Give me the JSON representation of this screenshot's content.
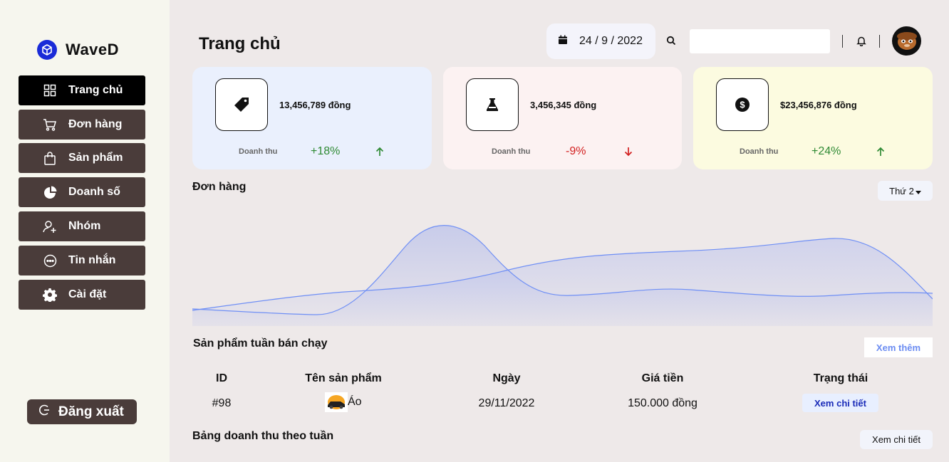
{
  "brand": {
    "name": "WaveD",
    "color": "#1a2bd8"
  },
  "sidebar": {
    "items": [
      {
        "label": "Trang chủ",
        "icon": "grid-icon",
        "active": true
      },
      {
        "label": "Đơn hàng",
        "icon": "cart-icon"
      },
      {
        "label": "Sản phẩm",
        "icon": "bag-icon"
      },
      {
        "label": "Doanh số",
        "icon": "pie-chart-icon"
      },
      {
        "label": "Nhóm",
        "icon": "user-add-icon"
      },
      {
        "label": "Tin nhắn",
        "icon": "message-icon"
      },
      {
        "label": "Cài đặt",
        "icon": "gear-icon"
      }
    ],
    "logout_label": "Đăng xuất"
  },
  "header": {
    "title": "Trang chủ",
    "date": "24 / 9 / 2022",
    "search_placeholder": ""
  },
  "stats": [
    {
      "amount": "13,456,789 đồng",
      "label": "Doanh thu",
      "change": "+18%",
      "trend": "up",
      "icon": "price-tag-icon",
      "bg": "#eaf0fd"
    },
    {
      "amount": "3,456,345 đồng",
      "label": "Doanh thu",
      "change": "-9%",
      "trend": "down",
      "icon": "flask-icon",
      "bg": "#fcf2f2"
    },
    {
      "amount": "$23,456,876 đồng",
      "label": "Doanh thu",
      "change": "+24%",
      "trend": "up",
      "icon": "dollar-icon",
      "bg": "#fcfbe0"
    }
  ],
  "orders": {
    "title": "Đơn hàng",
    "day_select": "Thứ 2"
  },
  "top_products": {
    "title": "Sản phẩm tuần bán chạy",
    "more_label": "Xem thêm",
    "columns": [
      "ID",
      "Tên sản phẩm",
      "Ngày",
      "Giá tiền",
      "Trạng thái"
    ],
    "rows": [
      {
        "id": "#98",
        "name": "Áo",
        "date": "29/11/2022",
        "price": "150.000 đồng",
        "status": "Xem chi tiết"
      }
    ]
  },
  "weekly_revenue": {
    "title": "Bảng doanh thu theo tuần",
    "detail_label": "Xem chi tiết"
  }
}
